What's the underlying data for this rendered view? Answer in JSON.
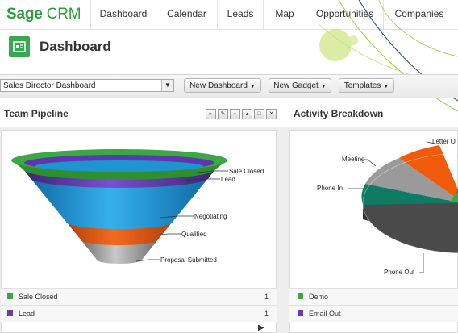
{
  "brand": {
    "sage": "Sage",
    "crm": "CRM"
  },
  "nav": [
    "Dashboard",
    "Calendar",
    "Leads",
    "Map",
    "Opportunities",
    "Companies"
  ],
  "page": {
    "title": "Dashboard"
  },
  "toolbar": {
    "dashboard_select": "Sales Director Dashboard",
    "new_dashboard": "New Dashboard",
    "new_gadget": "New Gadget",
    "templates": "Templates"
  },
  "gadgets": {
    "pipeline": {
      "title": "Team Pipeline",
      "labels": {
        "sale_closed": "Sale Closed",
        "lead": "Lead",
        "negotiating": "Negotiating",
        "qualified": "Qualified",
        "proposal_submitted": "Proposal Submitted"
      },
      "legend": [
        {
          "label": "Sale Closed",
          "count": "1",
          "color": "#3aa843"
        },
        {
          "label": "Lead",
          "count": "1",
          "color": "#6a3ab3"
        }
      ]
    },
    "activity": {
      "title": "Activity Breakdown",
      "labels": {
        "letter_out": "Letter O",
        "meeting": "Meeting",
        "phone_in": "Phone In",
        "phone_out": "Phone Out"
      },
      "legend": [
        {
          "label": "Demo",
          "color": "#3aa843"
        },
        {
          "label": "Email Out",
          "color": "#6a3ab3"
        }
      ]
    }
  },
  "colors": {
    "brand_green": "#2d9e3e",
    "funnel_green": "#39a43c",
    "funnel_purple": "#5a3aa8",
    "funnel_blue": "#1f9ad6",
    "funnel_orange": "#e55b12",
    "funnel_grey": "#9a9a9a",
    "pie_dark": "#4a4a4a",
    "pie_orange": "#f05a0a",
    "pie_grey": "#9a9a9a",
    "pie_teal": "#0f7b63"
  }
}
